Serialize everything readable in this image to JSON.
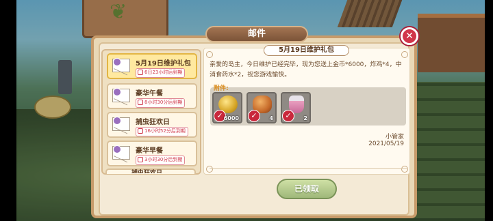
{
  "dialog": {
    "title": "邮件",
    "close_icon": "close-icon"
  },
  "mail_list": [
    {
      "title": "5月19日维护礼包",
      "expire": "6日23小时后到期",
      "selected": true
    },
    {
      "title": "豪华午餐",
      "expire": "8小时30分后到期",
      "selected": false
    },
    {
      "title": "捕虫狂欢日",
      "expire": "16小时52分后到期",
      "selected": false
    },
    {
      "title": "豪华早餐",
      "expire": "3小时30分后到期",
      "selected": false
    },
    {
      "title": "捕虫狂欢日",
      "expire": "",
      "selected": false
    }
  ],
  "detail": {
    "subject": "5月19日维护礼包",
    "body": "亲爱的岛主，今日维护已经完毕，现为您送上金币*6000，炸鸡*4，中消食药水*2，祝您游戏愉快。",
    "attachments_label": "附件:",
    "attachments": [
      {
        "icon": "gold-coin-icon",
        "qty": "6000"
      },
      {
        "icon": "fried-chicken-icon",
        "qty": "4"
      },
      {
        "icon": "potion-icon",
        "qty": "2"
      }
    ],
    "sender": "小管家",
    "date": "2021/05/19"
  },
  "claim_button": "已领取",
  "colors": {
    "panel_border": "#c79b6a",
    "close_button": "#d1354a",
    "selected_mail": "#ffe9a0",
    "claim_button": "#9fb87a"
  }
}
